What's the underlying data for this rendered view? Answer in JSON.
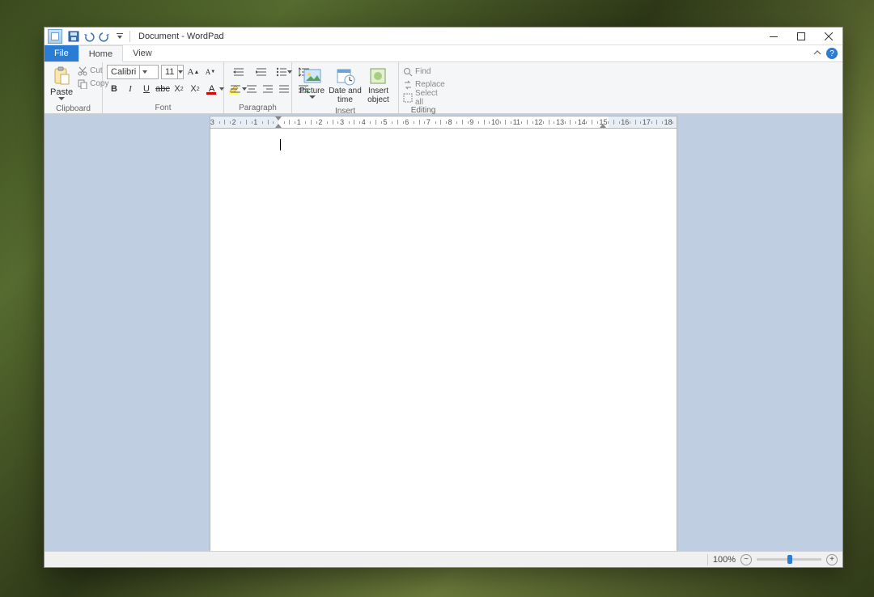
{
  "title": "Document - WordPad",
  "tabs": {
    "file": "File",
    "home": "Home",
    "view": "View"
  },
  "clipboard": {
    "paste": "Paste",
    "cut": "Cut",
    "copy": "Copy",
    "group": "Clipboard"
  },
  "font": {
    "family": "Calibri",
    "size": "11",
    "group": "Font"
  },
  "paragraph": {
    "group": "Paragraph"
  },
  "insert": {
    "picture": "Picture",
    "datetime": "Date and time",
    "object": "Insert object",
    "group": "Insert"
  },
  "editing": {
    "find": "Find",
    "replace": "Replace",
    "selectall": "Select all",
    "group": "Editing"
  },
  "ruler": {
    "min": -3,
    "max": 18,
    "labels": [
      "3",
      "2",
      "1",
      "1",
      "2",
      "3",
      "4",
      "5",
      "6",
      "7",
      "8",
      "9",
      "10",
      "11",
      "12",
      "13",
      "14",
      "15",
      "16",
      "17",
      "18"
    ]
  },
  "status": {
    "zoom": "100%"
  }
}
